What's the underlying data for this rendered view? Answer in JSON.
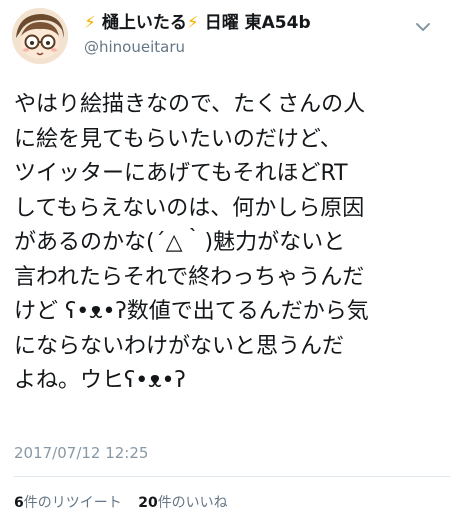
{
  "tweet": {
    "author": {
      "bolt_left": "⚡",
      "name": "樋上いたる",
      "bolt_right": "⚡",
      "suffix": "日曜 東A54b",
      "handle": "@hinoueitaru"
    },
    "text": "やはり絵描きなので、たくさんの人\nに絵を見てもらいたいのだけど、\nツイッターにあげてもそれほどRT\nしてもらえないのは、何かしら原因\nがあるのかな(´△｀)魅力がないと\n言われたらそれで終わっちゃうんだ\nけど ʕ•ᴥ•ʔ数値で出てるんだから気\nにならないわけがないと思うんだ\nよね。ウヒʕ•ᴥ•ʔ",
    "timestamp": "2017/07/12 12:25",
    "stats": {
      "retweets_count": "6",
      "retweets_label": "件のリツイート",
      "likes_count": "20",
      "likes_label": "件のいいね"
    },
    "icons": {
      "avatar": "avatar-illustration",
      "menu": "chevron-down-icon"
    },
    "colors": {
      "bolt": "#f5b400",
      "muted": "#657786",
      "timestamp": "#8899a6",
      "divider": "#e1e8ed"
    }
  }
}
